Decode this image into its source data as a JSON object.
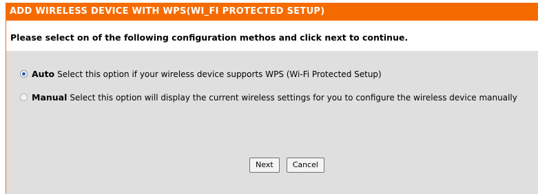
{
  "panel": {
    "header_title": "ADD WIRELESS DEVICE WITH WPS(WI_FI PROTECTED SETUP)",
    "instruction": "Please select on of the following configuration methos and click next to continue."
  },
  "options": [
    {
      "title": "Auto",
      "description": "Select this option if your wireless device supports WPS (Wi-Fi Protected Setup)",
      "selected": true
    },
    {
      "title": "Manual",
      "description": "Select this option will display the current wireless settings for you to configure the wireless device manually",
      "selected": false
    }
  ],
  "buttons": {
    "next_label": "Next",
    "cancel_label": "Cancel"
  },
  "colors": {
    "header_bg": "#f66b00",
    "panel_bg": "#dfdfdf",
    "radio_accent": "#2a5bb9"
  }
}
